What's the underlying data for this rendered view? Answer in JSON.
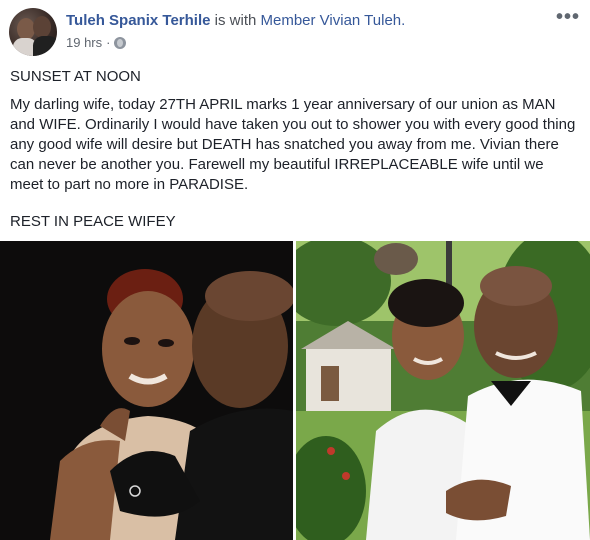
{
  "post": {
    "author": "Tuleh Spanix Terhile",
    "with_text": " is with ",
    "tagged": "Member Vivian Tuleh.",
    "time": "19 hrs",
    "dot": "·",
    "privacy_icon": "globe-icon",
    "menu_icon": "more-options-icon",
    "title": "SUNSET AT NOON",
    "message": "My darling wife, today 27TH APRIL marks 1 year anniversary of our union as MAN and WIFE. Ordinarily I would have taken you out to shower you with every good thing any good wife will desire but DEATH has snatched you away from me. Vivian there can never be another you. Farewell my beautiful IRREPLACEABLE wife until we meet to part no more in PARADISE.",
    "closing": "REST IN PEACE WIFEY"
  },
  "colors": {
    "link": "#365899",
    "meta": "#616770",
    "text": "#1d2129"
  }
}
